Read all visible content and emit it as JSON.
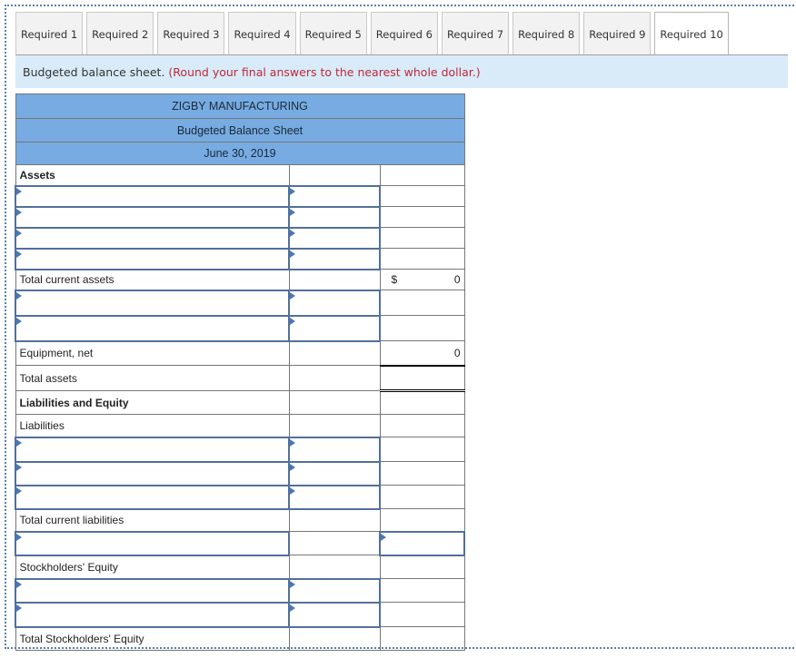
{
  "tabs": [
    {
      "label": "Required 1",
      "active": false
    },
    {
      "label": "Required 2",
      "active": false
    },
    {
      "label": "Required 3",
      "active": false
    },
    {
      "label": "Required 4",
      "active": false
    },
    {
      "label": "Required 5",
      "active": false
    },
    {
      "label": "Required 6",
      "active": false
    },
    {
      "label": "Required 7",
      "active": false
    },
    {
      "label": "Required 8",
      "active": false
    },
    {
      "label": "Required 9",
      "active": false
    },
    {
      "label": "Required 10",
      "active": true
    }
  ],
  "instruction": {
    "text": "Budgeted balance sheet.",
    "note": "(Round your final answers to the nearest whole dollar.)"
  },
  "sheet": {
    "company": "ZIGBY MANUFACTURING",
    "title": "Budgeted Balance Sheet",
    "date": "June 30, 2019",
    "assets_heading": "Assets",
    "total_current_assets_label": "Total current assets",
    "total_current_assets_currency": "$",
    "total_current_assets_value": "0",
    "equipment_label": "Equipment, net",
    "equipment_value": "0",
    "total_assets_label": "Total assets",
    "liab_equity_heading": "Liabilities and Equity",
    "liabilities_heading": "Liabilities",
    "total_current_liabilities_label": "Total current liabilities",
    "stockholders_equity_heading": "Stockholders' Equity",
    "total_stockholders_equity_label": "Total Stockholders' Equity"
  }
}
